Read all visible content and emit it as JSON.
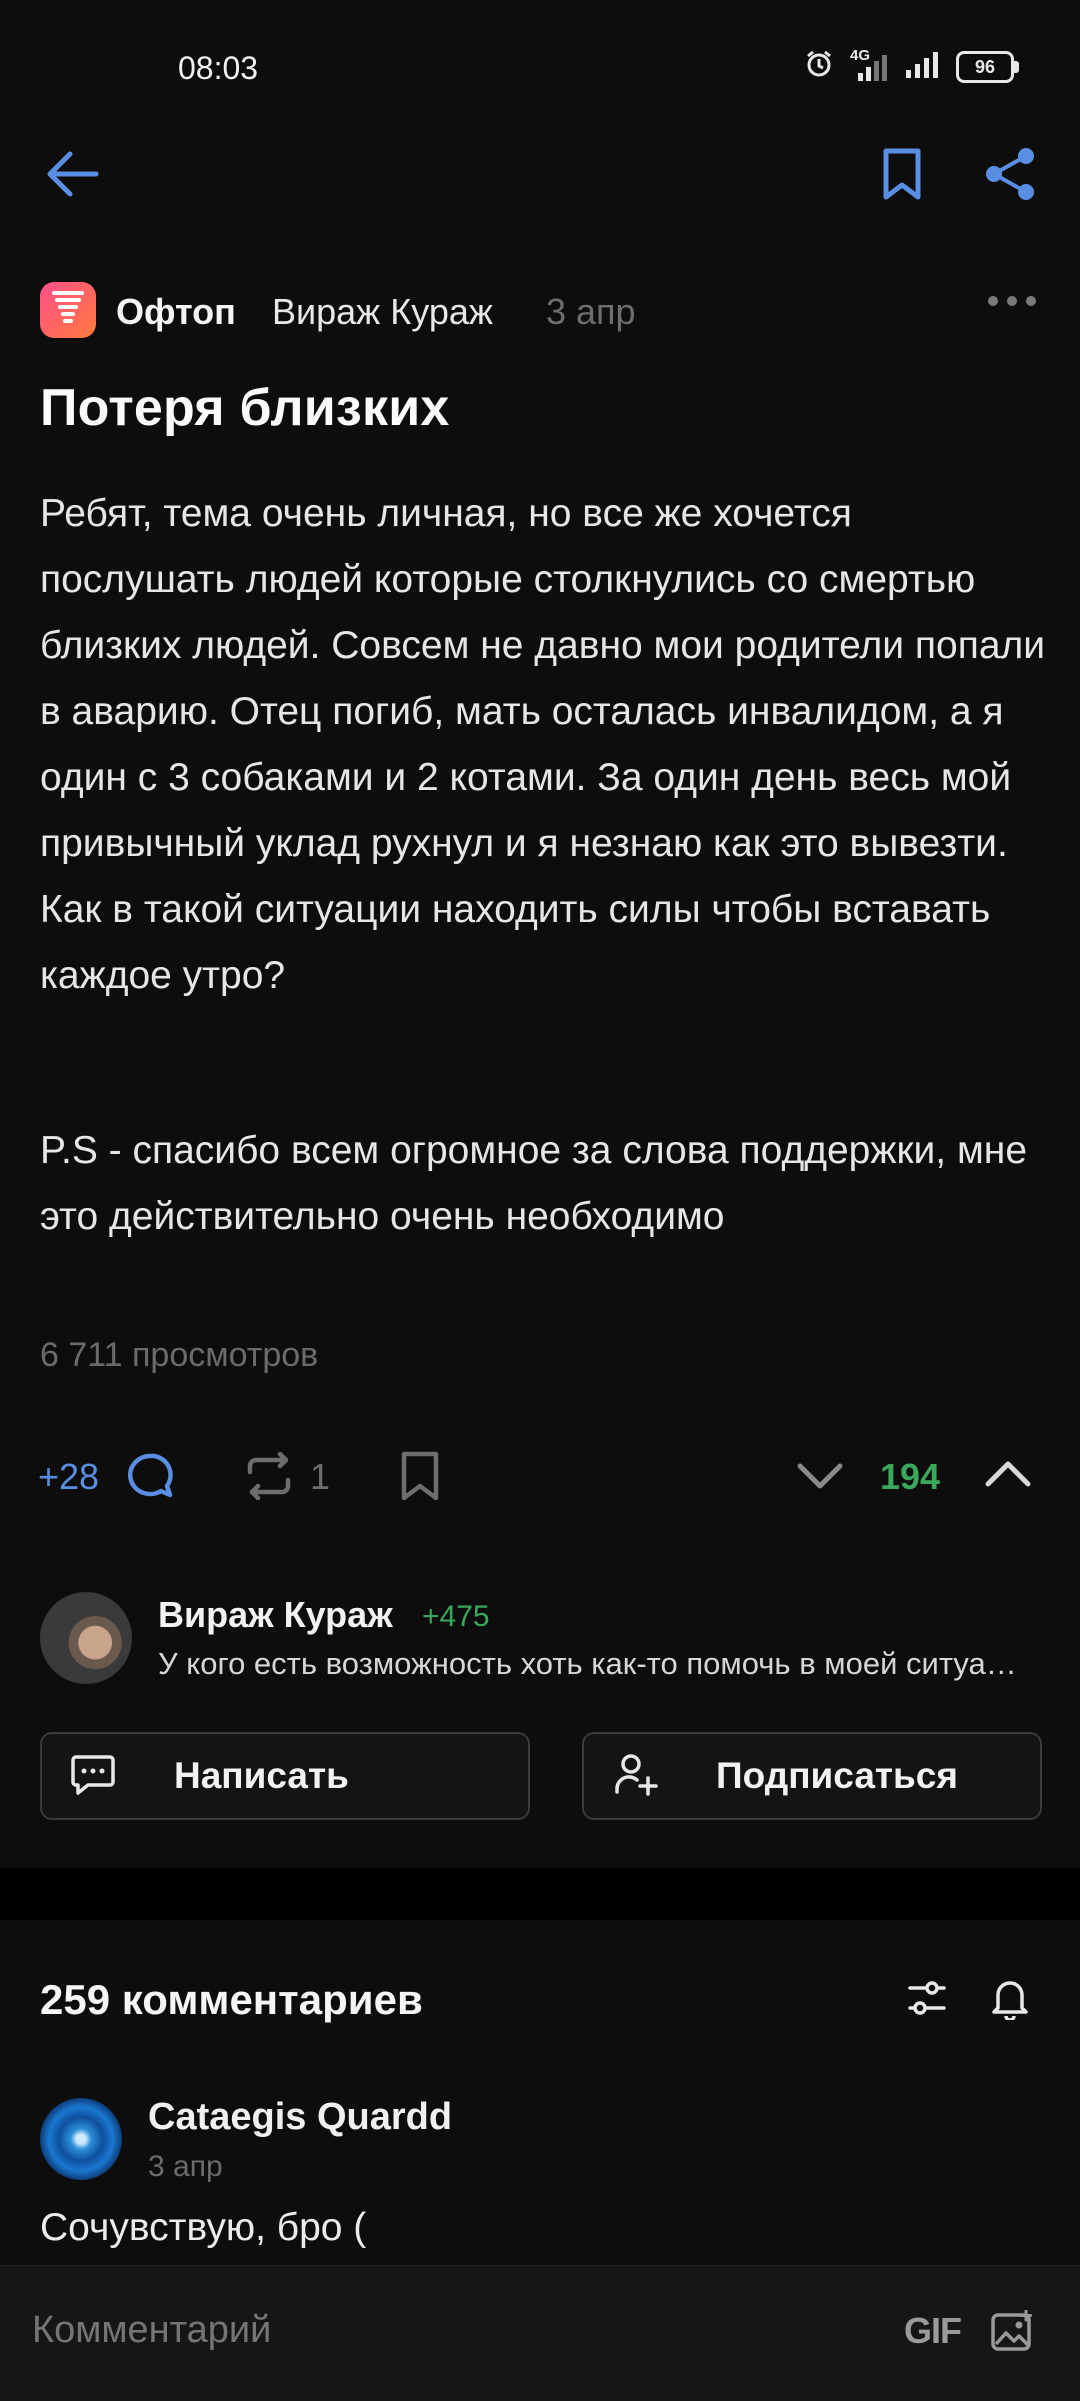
{
  "status_bar": {
    "time": "08:03",
    "network": "4G",
    "battery": "96",
    "icons": [
      "alarm-icon",
      "signal-4g-icon",
      "signal-icon",
      "battery-icon"
    ]
  },
  "toolbar": {
    "icons": [
      "back-arrow-icon",
      "bookmark-icon",
      "share-icon"
    ],
    "accent_color": "#5a8ee2"
  },
  "post": {
    "community": "Офтоп",
    "author": "Вираж Кураж",
    "date": "3 апр",
    "title": "Потеря близких",
    "body": "Ребят, тема очень личная, но все же хочется послушать людей которые столкнулись со смертью близких людей. Совсем не давно мои родители попали в аварию. Отец погиб, мать осталась инвалидом, а я один с 3 собаками и 2 котами. За один день весь мой привычный уклад рухнул и я незнаю как это вывезти. Как в такой ситуации находить силы чтобы вставать каждое утро?",
    "ps": "P.S - спасибо всем огромное за слова поддержки, мне это действительно очень необходимо",
    "views": "6 711 просмотров"
  },
  "actions": {
    "comments_plus": "+28",
    "reposts": "1",
    "rating": "194",
    "rating_color": "#3aa85a"
  },
  "author_card": {
    "name": "Вираж Кураж",
    "karma": "+475",
    "description": "У кого есть возможность хоть как-то помочь в моей ситуации",
    "write_label": "Написать",
    "subscribe_label": "Подписаться"
  },
  "comments": {
    "title": "259 комментариев",
    "items": [
      {
        "author": "Cataegis Quardd",
        "date": "3 апр",
        "text": "Сочувствую, бро ("
      }
    ]
  },
  "composer": {
    "placeholder": "Комментарий",
    "gif_label": "GIF"
  }
}
